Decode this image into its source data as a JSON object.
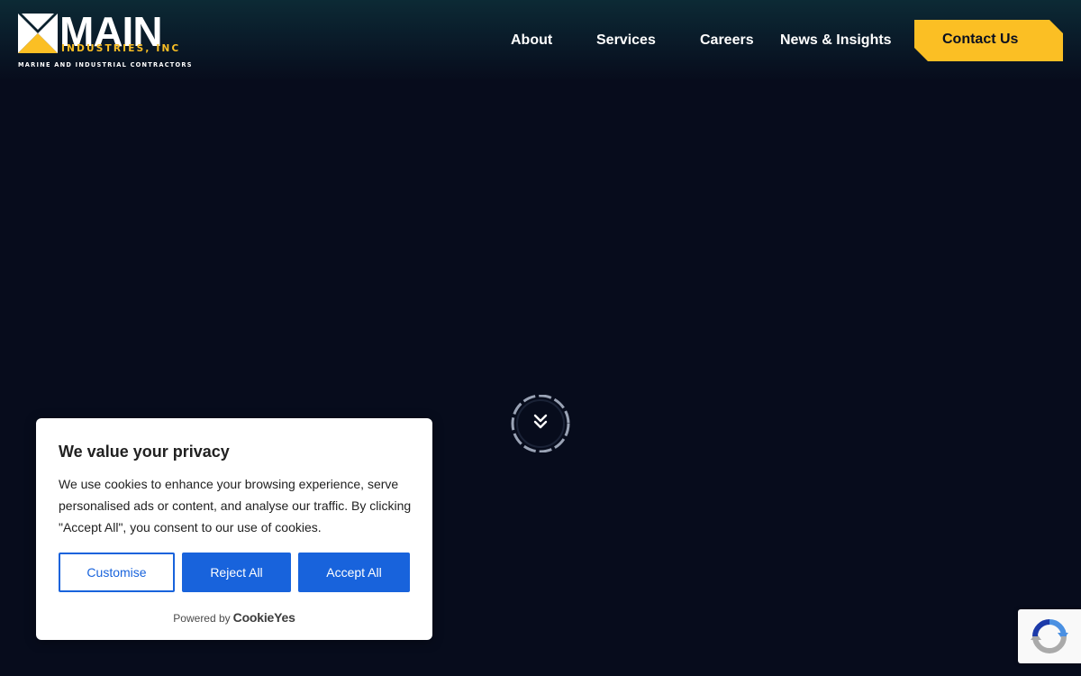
{
  "logo": {
    "main": "MAIN",
    "sub": "INDUSTRIES, INC",
    "tagline": "MARINE AND INDUSTRIAL CONTRACTORS"
  },
  "nav": {
    "items": [
      {
        "label": "About"
      },
      {
        "label": "Services"
      },
      {
        "label": "Careers"
      },
      {
        "label": "News & Insights"
      }
    ],
    "contact_label": "Contact Us"
  },
  "colors": {
    "background": "#070c1c",
    "accent": "#fbbf24",
    "cookie_button": "#1863dc"
  },
  "scroll": {
    "icon": "double-chevron-down-icon"
  },
  "cookie_banner": {
    "title": "We value your privacy",
    "text": "We use cookies to enhance your browsing experience, serve personalised ads or content, and analyse our traffic. By clicking \"Accept All\", you consent to our use of cookies.",
    "customise_label": "Customise",
    "reject_label": "Reject All",
    "accept_label": "Accept All",
    "powered_by": "Powered by",
    "brand": "CookieYes"
  },
  "recaptcha": {
    "icon": "recaptcha-icon"
  }
}
